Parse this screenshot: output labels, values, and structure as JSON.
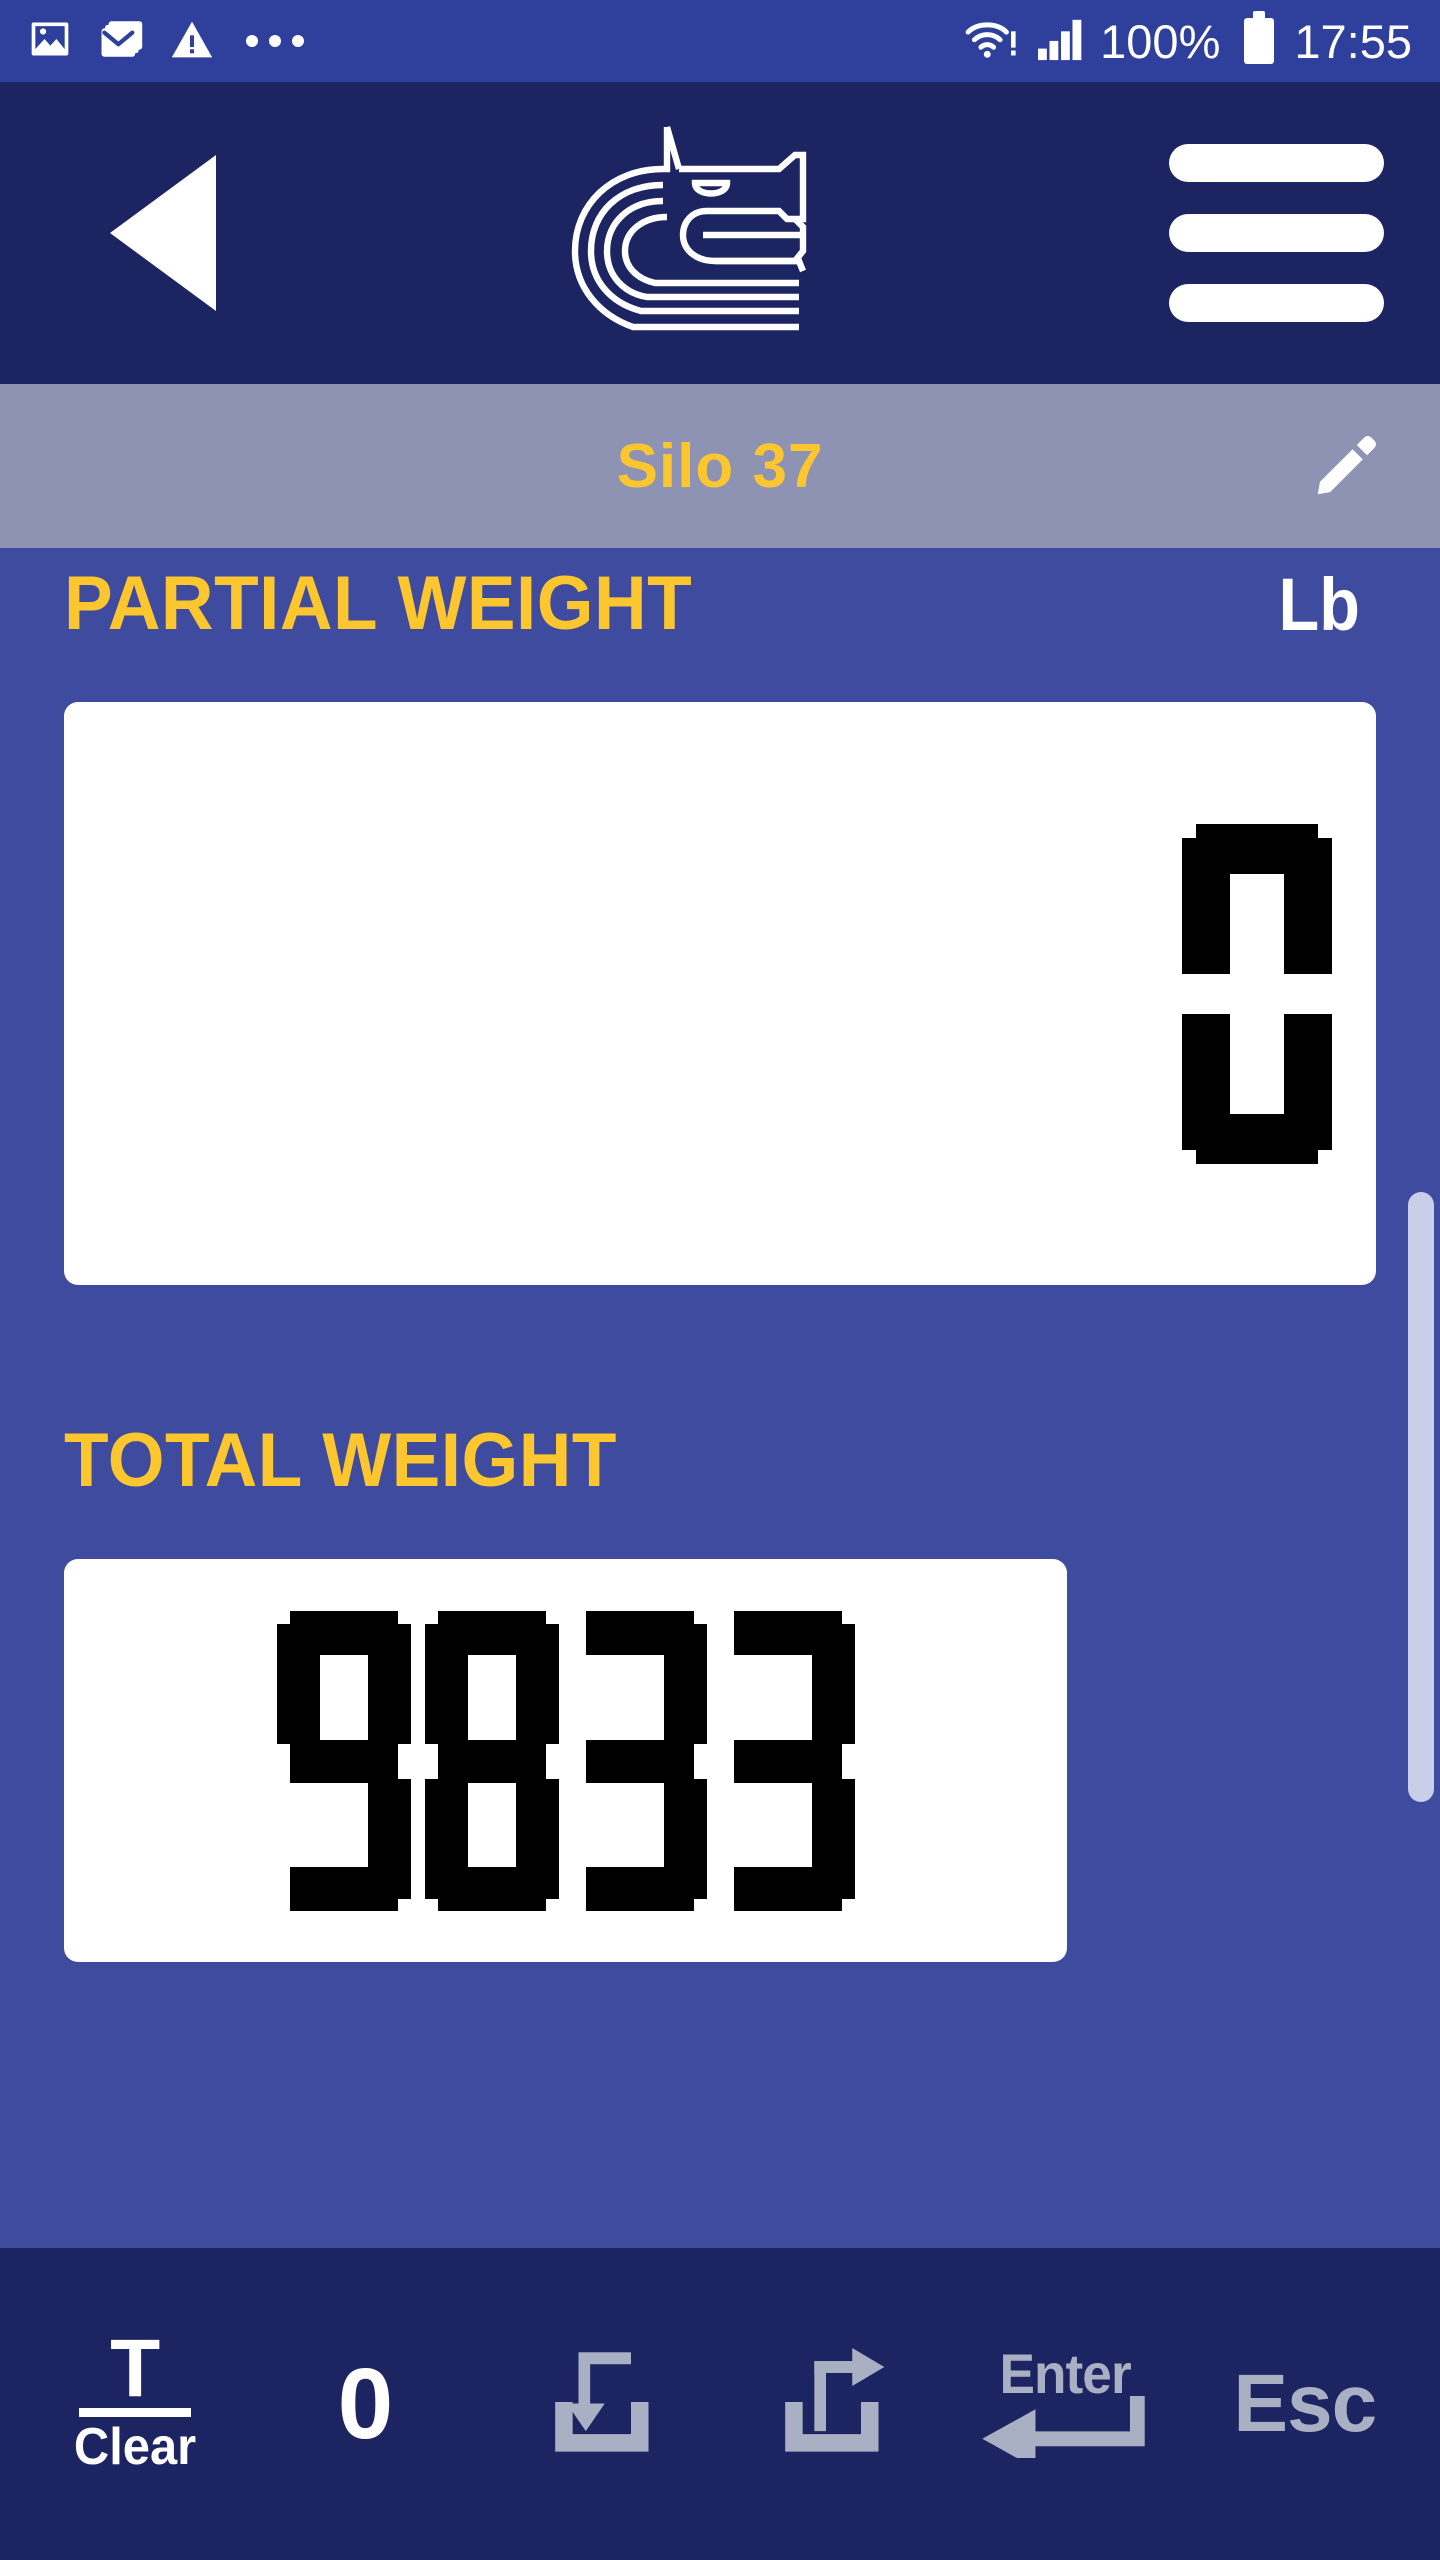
{
  "status_bar": {
    "left_icons": [
      {
        "name": "gallery-icon",
        "label": "Gallery"
      },
      {
        "name": "mail-icon",
        "label": "Mail"
      },
      {
        "name": "warning-icon",
        "label": "Warning"
      },
      {
        "name": "more-dots-icon",
        "label": "More"
      }
    ],
    "wifi_icon": "wifi-warning-icon",
    "signal_icon": "cellular-signal-icon",
    "battery_percent": "100%",
    "battery_icon": "battery-full-icon",
    "time": "17:55"
  },
  "app_bar": {
    "back_icon": "back-arrow-icon",
    "logo_icon": "horse-head-logo",
    "menu_icon": "hamburger-menu-icon"
  },
  "title_bar": {
    "title": "Silo 37",
    "edit_icon": "pencil-edit-icon",
    "background_color": "#8e93b4",
    "title_color": "#fcc62f"
  },
  "main": {
    "partial": {
      "label": "PARTIAL WEIGHT",
      "unit": "Lb",
      "value": "0",
      "digits": [
        "0"
      ]
    },
    "total": {
      "label": "TOTAL WEIGHT",
      "value": "9833",
      "digits": [
        "9",
        "8",
        "3",
        "3"
      ]
    },
    "accent_color": "#fcc62f",
    "background_color": "#3f4b9e",
    "display_background": "#ffffff",
    "segment_color": "#000000"
  },
  "scrollbar": {
    "thumb_color": "#c9cfe8"
  },
  "toolbar": {
    "background_color": "#1c2461",
    "icon_color": "#a9b0c4",
    "buttons": [
      {
        "name": "tare-clear-button",
        "top_label": "T",
        "bottom_label": "Clear"
      },
      {
        "name": "zero-button",
        "label": "0"
      },
      {
        "name": "load-in-button",
        "icon": "arrow-into-tray-icon"
      },
      {
        "name": "load-out-button",
        "icon": "arrow-out-of-tray-icon"
      },
      {
        "name": "enter-button",
        "label": "Enter",
        "icon": "return-arrow-icon"
      },
      {
        "name": "esc-button",
        "label": "Esc"
      }
    ]
  }
}
